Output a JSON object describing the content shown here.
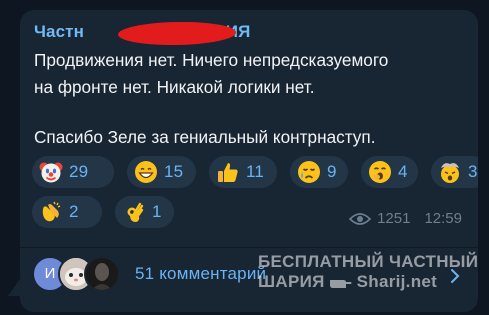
{
  "post": {
    "channel_name_visible_start": "Частн",
    "channel_name_visible_end": "АРИЯ",
    "lines": [
      "Продвижения нет. Ничего непредсказуемого",
      "на фронте нет. Никакой логики нет."
    ],
    "line3": "Спасибо Зеле за гениальный контрнаступ."
  },
  "reactions": [
    {
      "icon": "clown-face-icon",
      "count": "29"
    },
    {
      "icon": "grinning-face-icon",
      "count": "15"
    },
    {
      "icon": "thumbs-up-icon",
      "count": "11"
    },
    {
      "icon": "crying-face-icon",
      "count": "9"
    },
    {
      "icon": "yawning-face-icon",
      "count": "4"
    },
    {
      "icon": "exploding-head-icon",
      "count": "3"
    },
    {
      "icon": "clapping-hands-icon",
      "count": "2"
    },
    {
      "icon": "ok-hand-icon",
      "count": "1"
    }
  ],
  "meta": {
    "views": "1251",
    "time": "12:59"
  },
  "comments": {
    "avatar_letter": "И",
    "label": "51 комментарий"
  },
  "watermark": {
    "line1": "БЕСПЛАТНЫЙ ЧАСТНЫЙ",
    "line2_left": "ШАРИЯ",
    "line2_right": "Sharij.net"
  },
  "colors": {
    "background": "#0e1621",
    "bubble": "#182533",
    "accent": "#6ab3f3",
    "channel_name": "#71baf4",
    "redaction": "#e21c1c"
  }
}
